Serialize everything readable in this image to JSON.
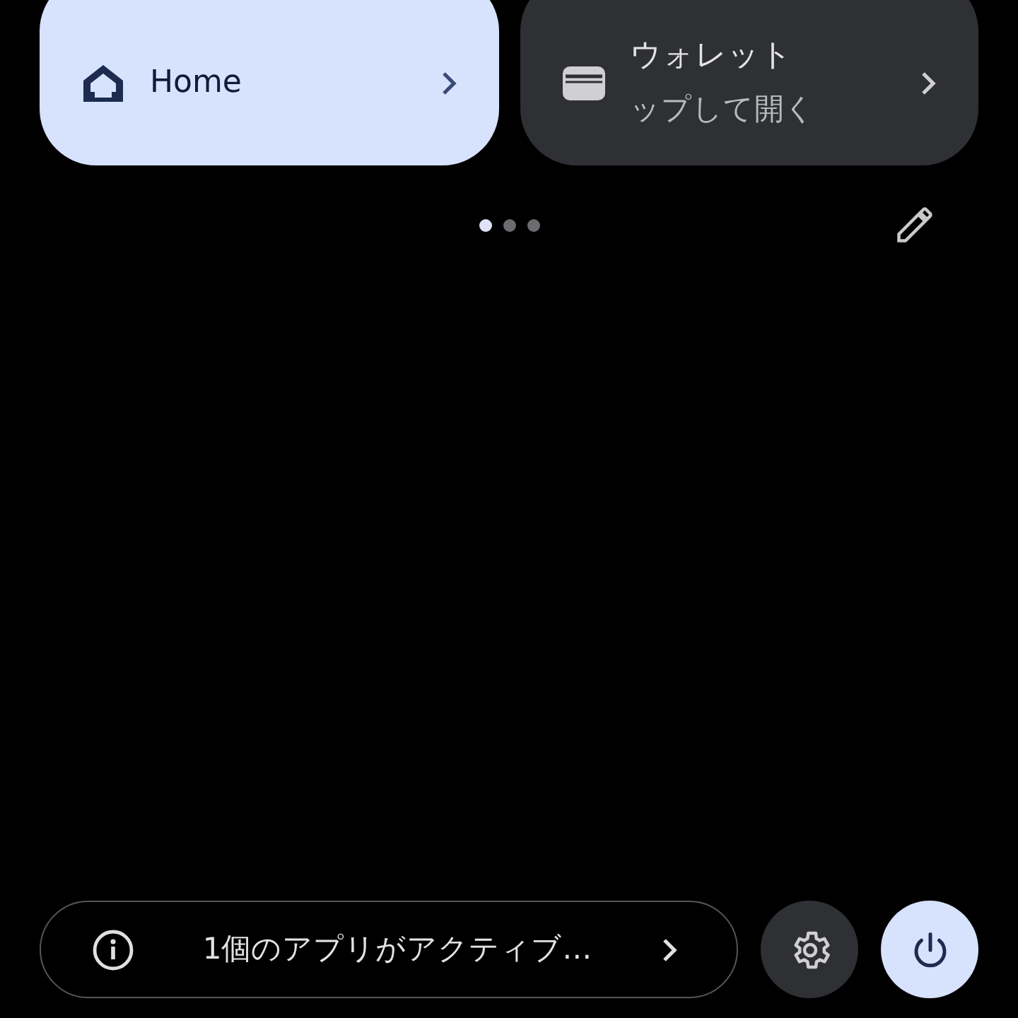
{
  "tiles": [
    {
      "kind": "home",
      "title": "Home",
      "active": true
    },
    {
      "kind": "wallet",
      "title": "ウォレット",
      "subtitle": "ップして開く",
      "active": false
    }
  ],
  "page_dots": [
    {
      "selected": true
    },
    {
      "selected": false
    },
    {
      "selected": false
    }
  ],
  "footer": {
    "status_text": "1個のアプリがアクティブ…"
  }
}
